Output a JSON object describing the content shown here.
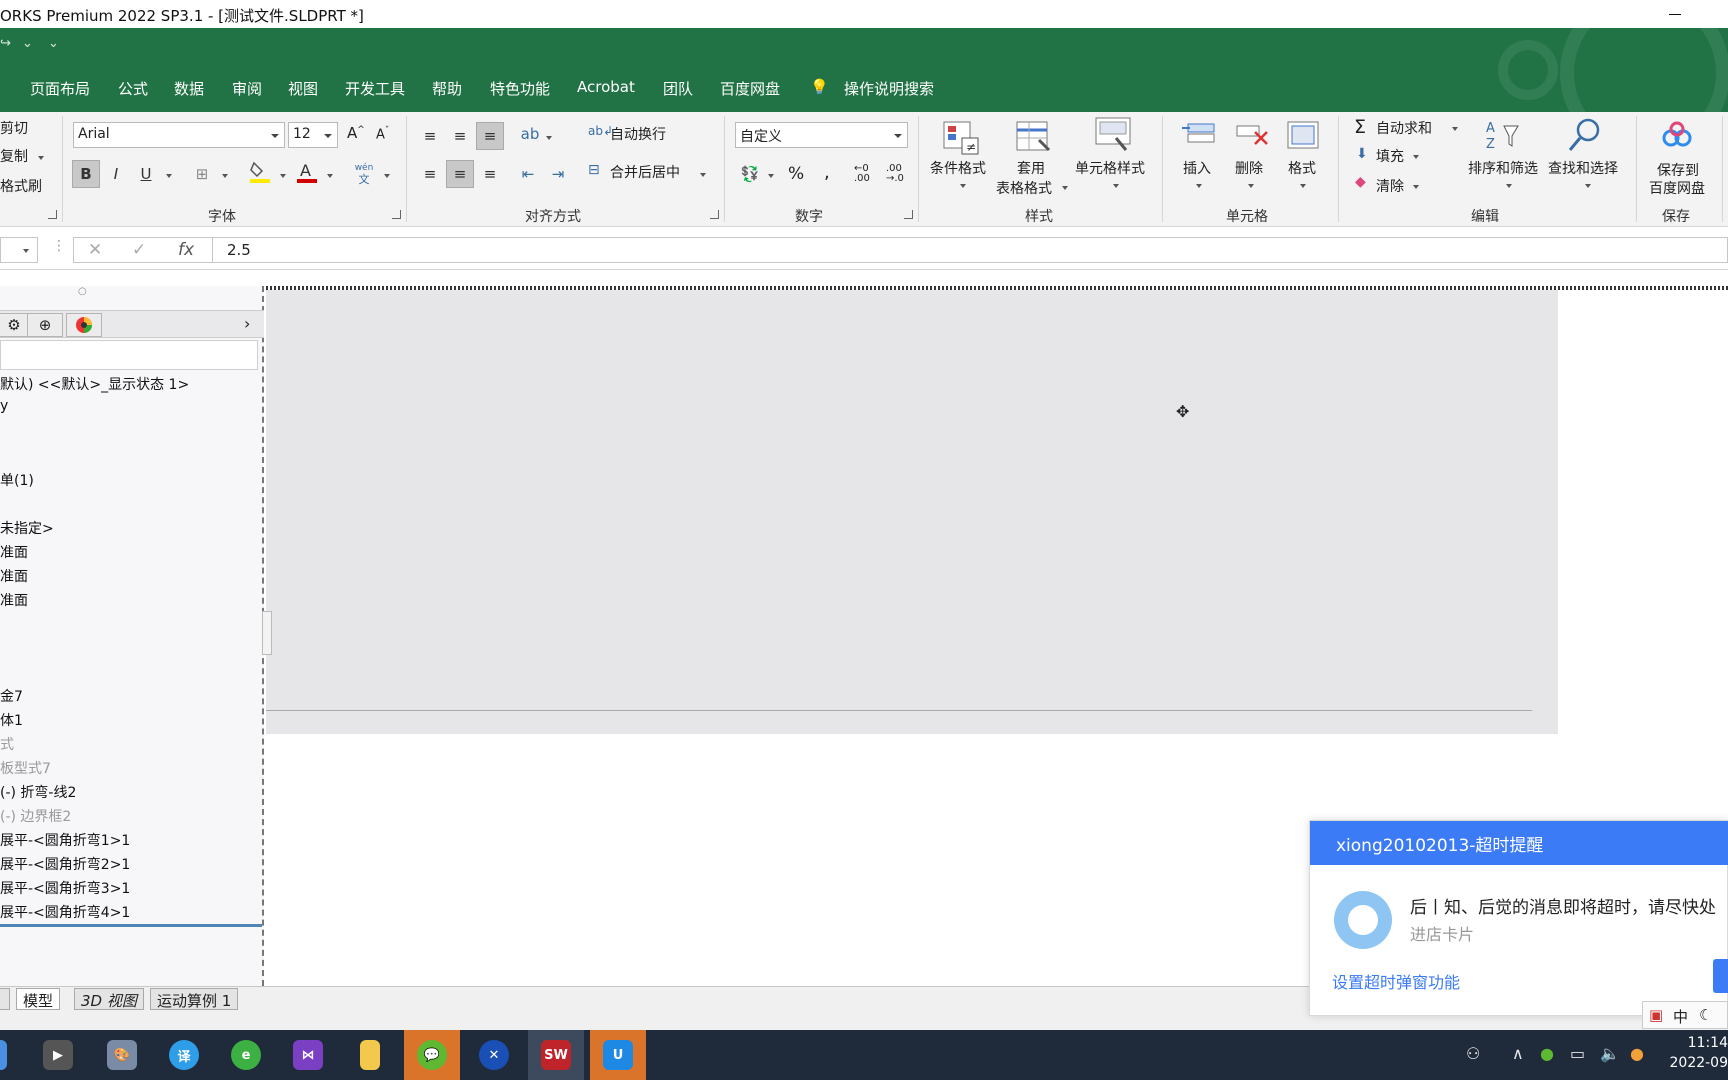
{
  "window": {
    "title": "ORKS Premium 2022 SP3.1 - [测试文件.SLDPRT *]"
  },
  "ribbon_tabs": [
    "页面布局",
    "公式",
    "数据",
    "审阅",
    "视图",
    "开发工具",
    "帮助",
    "特色功能",
    "Acrobat",
    "团队",
    "百度网盘",
    "操作说明搜索"
  ],
  "clipboard": {
    "cut": "剪切",
    "copy": "复制",
    "format_painter": "格式刷"
  },
  "font_group": {
    "label": "字体",
    "font_name": "Arial",
    "font_size": "12",
    "bold": "B",
    "italic": "I",
    "underline": "U",
    "font_color_letter": "A",
    "phonetic": "wén"
  },
  "alignment_group": {
    "label": "对齐方式",
    "wrap_text": "自动换行",
    "merge_center": "合并后居中"
  },
  "number_group": {
    "label": "数字",
    "format": "自定义",
    "percent": "%",
    "comma": ","
  },
  "styles_group": {
    "label": "样式",
    "conditional": "条件格式",
    "table_format_1": "套用",
    "table_format_2": "表格格式",
    "cell_styles": "单元格样式"
  },
  "cells_group": {
    "label": "单元格",
    "insert": "插入",
    "delete": "删除",
    "format": "格式"
  },
  "editing_group": {
    "label": "编辑",
    "autosum": "自动求和",
    "fill": "填充",
    "clear": "清除",
    "sort_filter": "排序和筛选",
    "find_select": "查找和选择"
  },
  "save_group": {
    "label": "保存",
    "save_1": "保存到",
    "save_2": "百度网盘"
  },
  "formula_bar": {
    "value": "2.5"
  },
  "feature_tree": [
    {
      "text": "默认) <<默认>_显示状态 1>",
      "dim": false
    },
    {
      "text": "y",
      "dim": false
    },
    {
      "text": "单(1)",
      "dim": false
    },
    {
      "text": "未指定>",
      "dim": false
    },
    {
      "text": "准面",
      "dim": false
    },
    {
      "text": "准面",
      "dim": false
    },
    {
      "text": "准面",
      "dim": false
    },
    {
      "text": "金7",
      "dim": false
    },
    {
      "text": "体1",
      "dim": false
    },
    {
      "text": "式",
      "dim": true
    },
    {
      "text": "板型式7",
      "dim": true
    },
    {
      "text": "(-) 折弯-线2",
      "dim": false
    },
    {
      "text": "(-) 边界框2",
      "dim": true
    },
    {
      "text": "展平-<圆角折弯1>1",
      "dim": false
    },
    {
      "text": "展平-<圆角折弯2>1",
      "dim": false
    },
    {
      "text": "展平-<圆角折弯3>1",
      "dim": false
    },
    {
      "text": "展平-<圆角折弯4>1",
      "dim": false
    }
  ],
  "sheet_tabs": [
    "模型",
    "3D 视图",
    "运动算例 1"
  ],
  "popup": {
    "title": "xiong20102013-超时提醒",
    "message": "后丨知、后觉的消息即将超时，请尽快处",
    "sub": "进店卡片",
    "link": "设置超时弹窗功能"
  },
  "ime": {
    "mode": "中"
  },
  "clock": {
    "time": "11:14",
    "date": "2022-09"
  },
  "colors": {
    "excel_green": "#217346",
    "popup_blue": "#3c7bf6",
    "taskbar": "#1f2a3a"
  }
}
